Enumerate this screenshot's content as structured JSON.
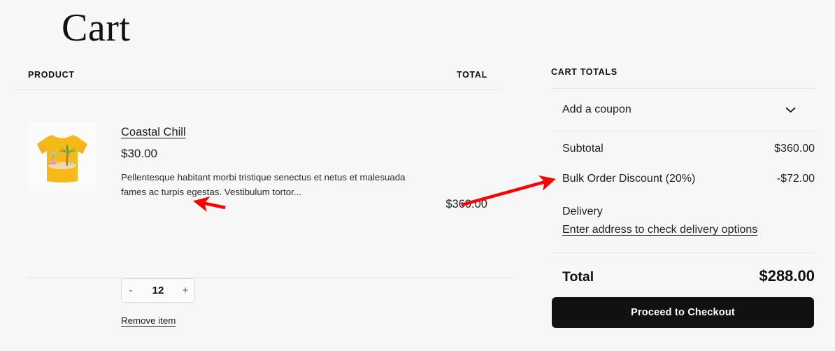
{
  "page": {
    "title": "Cart",
    "background_color": "#f7f7f7",
    "accent_color": "#111111",
    "annotation_color": "#ff0000"
  },
  "cart_table": {
    "headers": {
      "product": "PRODUCT",
      "total": "TOTAL"
    },
    "items": [
      {
        "name": "Coastal Chill",
        "unit_price": "$30.00",
        "description": "Pellentesque habitant morbi tristique senectus et netus et malesuada fames ac turpis egestas. Vestibulum tortor...",
        "quantity": "12",
        "decrement_label": "-",
        "increment_label": "+",
        "remove_label": "Remove item",
        "line_total": "$360.00",
        "thumbnail": {
          "icon": "tshirt-beach-graphic",
          "shirt_color": "#f5b91a",
          "shirt_shadow_color": "#e8a913",
          "palm_leaf_color": "#3f9b43",
          "palm_trunk_color": "#b07b3c",
          "umbrella_color": "#a8d8e8",
          "sand_color": "#f4d9a8",
          "chair_color": "#f0a0a8"
        }
      }
    ]
  },
  "cart_totals": {
    "title": "CART TOTALS",
    "coupon": {
      "label": "Add a coupon",
      "icon": "chevron-down-icon"
    },
    "lines": [
      {
        "label": "Subtotal",
        "value": "$360.00"
      },
      {
        "label": "Bulk Order Discount (20%)",
        "value": "-$72.00"
      }
    ],
    "delivery": {
      "label": "Delivery",
      "link": "Enter address to check delivery options"
    },
    "grand_total": {
      "label": "Total",
      "value": "$288.00"
    },
    "checkout_button": "Proceed to Checkout"
  },
  "annotations": [
    {
      "name": "arrow-to-quantity",
      "icon": "arrow-left-icon",
      "points_at": "quantity-stepper"
    },
    {
      "name": "arrow-to-bulk-discount",
      "icon": "arrow-up-right-icon",
      "points_at": "bulk-order-discount-row"
    }
  ]
}
